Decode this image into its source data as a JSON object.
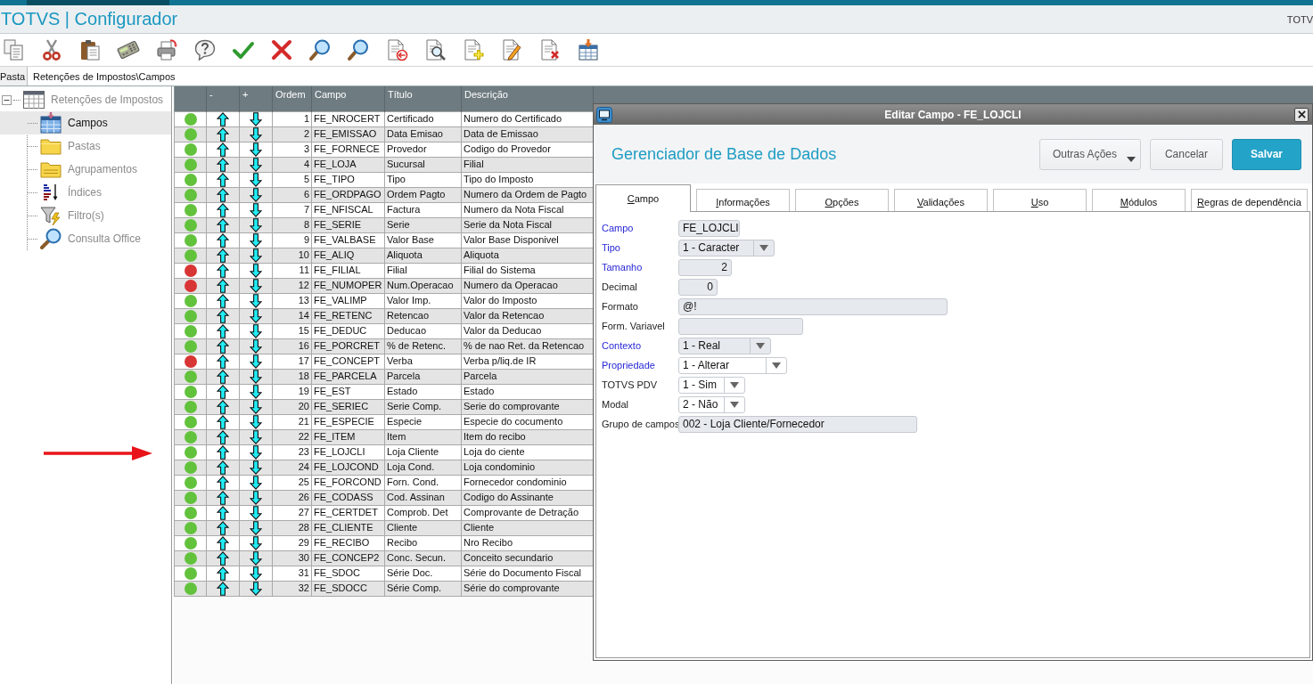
{
  "header": {
    "title": "TOTVS | Configurador",
    "right_text": "TOTV"
  },
  "path_bar": {
    "label": "Pasta",
    "value": "Retenções de Impostos\\Campos"
  },
  "tree": [
    {
      "label": "Retenções de Impostos",
      "kind": "table",
      "expanded": true,
      "selected": false,
      "children": [
        {
          "label": "Campos",
          "kind": "fields",
          "selected": true
        },
        {
          "label": "Pastas",
          "kind": "folder",
          "selected": false
        },
        {
          "label": "Agrupamentos",
          "kind": "grouping",
          "selected": false
        },
        {
          "label": "Índices",
          "kind": "index",
          "selected": false
        },
        {
          "label": "Filtro(s)",
          "kind": "filter",
          "selected": false
        },
        {
          "label": "Consulta Office",
          "kind": "query",
          "selected": false
        }
      ]
    }
  ],
  "table": {
    "columns": [
      "-",
      "+",
      "Ordem",
      "Campo",
      "Título",
      "Descrição"
    ],
    "rows": [
      {
        "color": "#62c23c",
        "order": "1",
        "field": "FE_NROCERT",
        "title": "Certificado",
        "description": "Numero do Certificado"
      },
      {
        "color": "#62c23c",
        "order": "2",
        "field": "FE_EMISSAO",
        "title": "Data Emisao",
        "description": "Data de Emissao"
      },
      {
        "color": "#62c23c",
        "order": "3",
        "field": "FE_FORNECE",
        "title": "Provedor",
        "description": "Codigo do Provedor"
      },
      {
        "color": "#62c23c",
        "order": "4",
        "field": "FE_LOJA",
        "title": "Sucursal",
        "description": "Filial"
      },
      {
        "color": "#62c23c",
        "order": "5",
        "field": "FE_TIPO",
        "title": "Tipo",
        "description": "Tipo do Imposto"
      },
      {
        "color": "#62c23c",
        "order": "6",
        "field": "FE_ORDPAGO",
        "title": "Ordem Pagto",
        "description": "Numero da Ordem de Pagto"
      },
      {
        "color": "#62c23c",
        "order": "7",
        "field": "FE_NFISCAL",
        "title": "Factura",
        "description": "Numero da Nota Fiscal"
      },
      {
        "color": "#62c23c",
        "order": "8",
        "field": "FE_SERIE",
        "title": "Serie",
        "description": "Serie da Nota Fiscal"
      },
      {
        "color": "#62c23c",
        "order": "9",
        "field": "FE_VALBASE",
        "title": "Valor Base",
        "description": "Valor Base Disponivel"
      },
      {
        "color": "#62c23c",
        "order": "10",
        "field": "FE_ALIQ",
        "title": "Aliquota",
        "description": "Aliquota"
      },
      {
        "color": "#d83535",
        "order": "11",
        "field": "FE_FILIAL",
        "title": "Filial",
        "description": "Filial do Sistema"
      },
      {
        "color": "#d83535",
        "order": "12",
        "field": "FE_NUMOPER",
        "title": "Num.Operacao",
        "description": "Numero da Operacao"
      },
      {
        "color": "#62c23c",
        "order": "13",
        "field": "FE_VALIMP",
        "title": "Valor Imp.",
        "description": "Valor do Imposto"
      },
      {
        "color": "#62c23c",
        "order": "14",
        "field": "FE_RETENC",
        "title": "Retencao",
        "description": "Valor da Retencao"
      },
      {
        "color": "#62c23c",
        "order": "15",
        "field": "FE_DEDUC",
        "title": "Deducao",
        "description": "Valor da Deducao"
      },
      {
        "color": "#62c23c",
        "order": "16",
        "field": "FE_PORCRET",
        "title": "% de Retenc.",
        "description": "% de nao Ret. da Retencao"
      },
      {
        "color": "#d83535",
        "order": "17",
        "field": "FE_CONCEPT",
        "title": "Verba",
        "description": "Verba p/liq.de IR"
      },
      {
        "color": "#62c23c",
        "order": "18",
        "field": "FE_PARCELA",
        "title": "Parcela",
        "description": "Parcela"
      },
      {
        "color": "#62c23c",
        "order": "19",
        "field": "FE_EST",
        "title": "Estado",
        "description": "Estado"
      },
      {
        "color": "#62c23c",
        "order": "20",
        "field": "FE_SERIEC",
        "title": "Serie Comp.",
        "description": "Serie do comprovante"
      },
      {
        "color": "#62c23c",
        "order": "21",
        "field": "FE_ESPECIE",
        "title": "Especie",
        "description": "Especie do cocumento"
      },
      {
        "color": "#62c23c",
        "order": "22",
        "field": "FE_ITEM",
        "title": "Item",
        "description": "Item do recibo"
      },
      {
        "color": "#62c23c",
        "order": "23",
        "field": "FE_LOJCLI",
        "title": "Loja Cliente",
        "description": "Loja do ciente"
      },
      {
        "color": "#62c23c",
        "order": "24",
        "field": "FE_LOJCOND",
        "title": "Loja Cond.",
        "description": "Loja condominio"
      },
      {
        "color": "#62c23c",
        "order": "25",
        "field": "FE_FORCOND",
        "title": "Forn. Cond.",
        "description": "Fornecedor condominio"
      },
      {
        "color": "#62c23c",
        "order": "26",
        "field": "FE_CODASS",
        "title": "Cod. Assinan",
        "description": "Codigo do Assinante"
      },
      {
        "color": "#62c23c",
        "order": "27",
        "field": "FE_CERTDET",
        "title": "Comprob. Det",
        "description": "Comprovante de Detração"
      },
      {
        "color": "#62c23c",
        "order": "28",
        "field": "FE_CLIENTE",
        "title": "Cliente",
        "description": "Cliente"
      },
      {
        "color": "#62c23c",
        "order": "29",
        "field": "FE_RECIBO",
        "title": "Recibo",
        "description": "Nro Recibo"
      },
      {
        "color": "#62c23c",
        "order": "30",
        "field": "FE_CONCEP2",
        "title": "Conc. Secun.",
        "description": "Conceito secundario"
      },
      {
        "color": "#62c23c",
        "order": "31",
        "field": "FE_SDOC",
        "title": "Série Doc.",
        "description": "Série do Documento Fiscal"
      },
      {
        "color": "#62c23c",
        "order": "32",
        "field": "FE_SDOCC",
        "title": "Série Comp.",
        "description": "Série do comprovante"
      }
    ]
  },
  "dialog": {
    "title": "Editar Campo - FE_LOJCLI",
    "heading": "Gerenciador de Base de Dados",
    "buttons": [
      {
        "label": "Outras Ações",
        "kind": "menu"
      },
      {
        "label": "Cancelar",
        "kind": "secondary"
      },
      {
        "label": "Salvar",
        "kind": "primary"
      }
    ],
    "tabs": [
      {
        "label": "Campo",
        "selected": true
      },
      {
        "label": "Informações",
        "selected": false
      },
      {
        "label": "Opções",
        "selected": false
      },
      {
        "label": "Validações",
        "selected": false
      },
      {
        "label": "Uso",
        "selected": false
      },
      {
        "label": "Módulos",
        "selected": false
      },
      {
        "label": "Regras de dependência",
        "selected": false
      }
    ],
    "fields": [
      {
        "label": "Campo",
        "required": true,
        "kind": "text",
        "disabled": true,
        "value": "FE_LOJCLI"
      },
      {
        "label": "Tipo",
        "required": true,
        "kind": "select",
        "disabled": true,
        "value": "1 - Caracter"
      },
      {
        "label": "Tamanho",
        "required": true,
        "kind": "number",
        "disabled": true,
        "value": "2"
      },
      {
        "label": "Decimal",
        "required": false,
        "kind": "number",
        "disabled": true,
        "value": "0"
      },
      {
        "label": "Formato",
        "required": false,
        "kind": "text",
        "disabled": true,
        "value": "@!"
      },
      {
        "label": "Form. Variavel",
        "required": false,
        "kind": "text",
        "disabled": true
      },
      {
        "label": "Contexto",
        "required": true,
        "kind": "select",
        "disabled": true,
        "value": "1 - Real"
      },
      {
        "label": "Propriedade",
        "required": true,
        "kind": "select",
        "disabled": false,
        "value": "1 - Alterar"
      },
      {
        "label": "TOTVS PDV",
        "required": false,
        "kind": "select",
        "disabled": false,
        "value": "1 - Sim"
      },
      {
        "label": "Modal",
        "required": false,
        "kind": "select",
        "disabled": false,
        "value": "2 - Não"
      },
      {
        "label": "Grupo de campos",
        "required": false,
        "kind": "text",
        "disabled": true,
        "value": "002 - Loja Cliente/Fornecedor"
      }
    ]
  }
}
